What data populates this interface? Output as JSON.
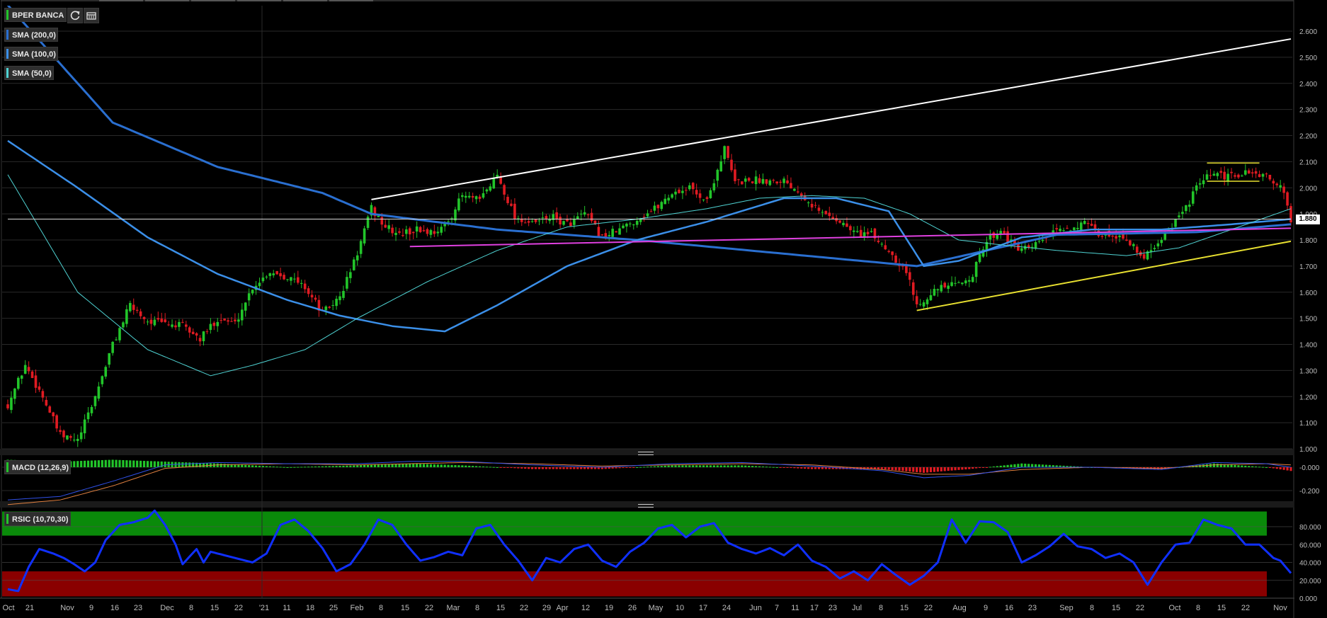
{
  "legends": {
    "main": "BPER BANCA",
    "sma200": "SMA (200,0)",
    "sma100": "SMA (100,0)",
    "sma50": "SMA (50,0)",
    "macd": "MACD (12,26,9)",
    "rsi": "RSIC (10,70,30)"
  },
  "toolbar_icons": [
    "refresh-icon",
    "calendar-icon"
  ],
  "last_price": "1.880",
  "colors": {
    "up": "#22c52a",
    "down": "#e01b22",
    "sma200": "#2a6fd0",
    "sma100": "#3b8fe8",
    "sma50": "#4fd3d3",
    "trend_white": "#ffffff",
    "trend_magenta": "#e040e0",
    "trend_yellow": "#e8e030",
    "macd_line": "#3050e8",
    "macd_signal": "#e08040",
    "macd_hist": "#22c52a",
    "rsi_line": "#1030ff",
    "rsi_overbought": "#0a8a0a",
    "rsi_oversold": "#8a0000"
  },
  "chart_data": [
    {
      "type": "candlestick",
      "title": "BPER BANCA",
      "y_ticks": [
        "1.000",
        "1.100",
        "1.200",
        "1.300",
        "1.400",
        "1.500",
        "1.600",
        "1.700",
        "1.800",
        "1.900",
        "2.000",
        "2.100",
        "2.200",
        "2.300",
        "2.400",
        "2.500",
        "2.600"
      ],
      "ylim": [
        1.0,
        2.65
      ],
      "x_ticks": [
        "Oct",
        "21",
        "Nov",
        "9",
        "16",
        "23",
        "Dec",
        "8",
        "15",
        "22",
        "'21",
        "11",
        "18",
        "25",
        "Feb",
        "8",
        "15",
        "22",
        "Mar",
        "8",
        "15",
        "22",
        "29",
        "Apr",
        "12",
        "19",
        "26",
        "May",
        "10",
        "17",
        "24",
        "Jun",
        "7",
        "11",
        "17",
        "23",
        "Jul",
        "8",
        "15",
        "22",
        "Aug",
        "9",
        "16",
        "23",
        "Sep",
        "8",
        "15",
        "22",
        "Oct",
        "8",
        "15",
        "22",
        "Nov"
      ],
      "price_keypoints": [
        [
          0,
          1.17
        ],
        [
          5,
          1.32
        ],
        [
          10,
          1.2
        ],
        [
          15,
          1.05
        ],
        [
          20,
          1.03
        ],
        [
          25,
          1.2
        ],
        [
          30,
          1.4
        ],
        [
          35,
          1.55
        ],
        [
          40,
          1.49
        ],
        [
          45,
          1.48
        ],
        [
          50,
          1.47
        ],
        [
          55,
          1.42
        ],
        [
          60,
          1.5
        ],
        [
          65,
          1.48
        ],
        [
          70,
          1.62
        ],
        [
          75,
          1.68
        ],
        [
          80,
          1.66
        ],
        [
          85,
          1.62
        ],
        [
          90,
          1.52
        ],
        [
          95,
          1.58
        ],
        [
          100,
          1.75
        ],
        [
          104,
          1.92
        ],
        [
          108,
          1.85
        ],
        [
          112,
          1.82
        ],
        [
          117,
          1.84
        ],
        [
          121,
          1.83
        ],
        [
          125,
          1.85
        ],
        [
          130,
          1.97
        ],
        [
          135,
          1.95
        ],
        [
          140,
          2.05
        ],
        [
          145,
          1.89
        ],
        [
          150,
          1.86
        ],
        [
          155,
          1.89
        ],
        [
          160,
          1.86
        ],
        [
          165,
          1.9
        ],
        [
          170,
          1.81
        ],
        [
          175,
          1.84
        ],
        [
          180,
          1.88
        ],
        [
          185,
          1.92
        ],
        [
          190,
          1.98
        ],
        [
          195,
          2.0
        ],
        [
          200,
          1.95
        ],
        [
          205,
          2.15
        ],
        [
          208,
          2.02
        ],
        [
          212,
          2.03
        ],
        [
          217,
          2.03
        ],
        [
          222,
          2.03
        ],
        [
          227,
          1.98
        ],
        [
          232,
          1.91
        ],
        [
          237,
          1.88
        ],
        [
          242,
          1.83
        ],
        [
          247,
          1.82
        ],
        [
          252,
          1.76
        ],
        [
          257,
          1.68
        ],
        [
          260,
          1.55
        ],
        [
          264,
          1.6
        ],
        [
          268,
          1.62
        ],
        [
          272,
          1.63
        ],
        [
          276,
          1.67
        ],
        [
          280,
          1.8
        ],
        [
          284,
          1.84
        ],
        [
          288,
          1.77
        ],
        [
          292,
          1.76
        ],
        [
          296,
          1.8
        ],
        [
          300,
          1.83
        ],
        [
          304,
          1.85
        ],
        [
          308,
          1.86
        ],
        [
          312,
          1.82
        ],
        [
          316,
          1.82
        ],
        [
          320,
          1.81
        ],
        [
          324,
          1.73
        ],
        [
          328,
          1.78
        ],
        [
          332,
          1.84
        ],
        [
          336,
          1.9
        ],
        [
          340,
          2.0
        ],
        [
          344,
          2.05
        ],
        [
          348,
          2.04
        ],
        [
          352,
          2.05
        ],
        [
          356,
          2.06
        ],
        [
          360,
          2.04
        ],
        [
          364,
          2.01
        ],
        [
          367,
          1.88
        ]
      ],
      "sma200_keypoints": [
        [
          0,
          2.7
        ],
        [
          10,
          2.55
        ],
        [
          30,
          2.25
        ],
        [
          60,
          2.08
        ],
        [
          90,
          1.98
        ],
        [
          104,
          1.9
        ],
        [
          140,
          1.84
        ],
        [
          180,
          1.8
        ],
        [
          220,
          1.75
        ],
        [
          260,
          1.7
        ],
        [
          300,
          1.82
        ],
        [
          340,
          1.83
        ],
        [
          367,
          1.86
        ]
      ],
      "sma100_keypoints": [
        [
          0,
          2.18
        ],
        [
          20,
          2.0
        ],
        [
          40,
          1.81
        ],
        [
          60,
          1.67
        ],
        [
          80,
          1.57
        ],
        [
          95,
          1.51
        ],
        [
          110,
          1.47
        ],
        [
          125,
          1.45
        ],
        [
          140,
          1.55
        ],
        [
          160,
          1.7
        ],
        [
          180,
          1.8
        ],
        [
          200,
          1.87
        ],
        [
          222,
          1.96
        ],
        [
          237,
          1.96
        ],
        [
          252,
          1.91
        ],
        [
          262,
          1.7
        ],
        [
          272,
          1.72
        ],
        [
          290,
          1.81
        ],
        [
          310,
          1.84
        ],
        [
          330,
          1.84
        ],
        [
          350,
          1.86
        ],
        [
          367,
          1.88
        ]
      ],
      "sma50_keypoints": [
        [
          0,
          2.05
        ],
        [
          20,
          1.6
        ],
        [
          40,
          1.38
        ],
        [
          58,
          1.28
        ],
        [
          70,
          1.32
        ],
        [
          85,
          1.38
        ],
        [
          100,
          1.5
        ],
        [
          120,
          1.64
        ],
        [
          140,
          1.76
        ],
        [
          160,
          1.85
        ],
        [
          180,
          1.88
        ],
        [
          200,
          1.92
        ],
        [
          215,
          1.96
        ],
        [
          230,
          1.97
        ],
        [
          245,
          1.96
        ],
        [
          258,
          1.9
        ],
        [
          272,
          1.8
        ],
        [
          285,
          1.78
        ],
        [
          300,
          1.76
        ],
        [
          320,
          1.74
        ],
        [
          335,
          1.77
        ],
        [
          350,
          1.84
        ],
        [
          367,
          1.92
        ]
      ],
      "trendlines": {
        "white": [
          [
            104,
            1.955
          ],
          [
            367,
            2.57
          ]
        ],
        "magenta": [
          [
            115,
            1.775
          ],
          [
            367,
            1.845
          ]
        ],
        "yellow": [
          [
            260,
            1.53
          ],
          [
            367,
            1.795
          ]
        ],
        "yellow_box_top": [
          [
            343,
            2.095
          ],
          [
            358,
            2.095
          ]
        ],
        "yellow_box_bottom": [
          [
            343,
            2.025
          ],
          [
            358,
            2.025
          ]
        ],
        "horizontal": [
          [
            0,
            1.88
          ],
          [
            367,
            1.88
          ]
        ]
      },
      "last": 1.88
    },
    {
      "type": "line",
      "title": "MACD (12,26,9)",
      "y_ticks": [
        "-0.000",
        "-0.200"
      ],
      "ylim": [
        -0.32,
        0.06
      ],
      "macd_keypoints": [
        [
          0,
          -0.28
        ],
        [
          15,
          -0.25
        ],
        [
          30,
          -0.12
        ],
        [
          45,
          0.02
        ],
        [
          60,
          0.04
        ],
        [
          80,
          0.03
        ],
        [
          100,
          0.03
        ],
        [
          115,
          0.05
        ],
        [
          130,
          0.05
        ],
        [
          150,
          0.02
        ],
        [
          170,
          0.0
        ],
        [
          190,
          0.03
        ],
        [
          210,
          0.04
        ],
        [
          230,
          0.01
        ],
        [
          250,
          -0.03
        ],
        [
          262,
          -0.09
        ],
        [
          275,
          -0.07
        ],
        [
          290,
          0.0
        ],
        [
          310,
          0.0
        ],
        [
          330,
          -0.02
        ],
        [
          345,
          0.04
        ],
        [
          360,
          0.03
        ],
        [
          367,
          0.0
        ]
      ],
      "signal_keypoints": [
        [
          0,
          -0.32
        ],
        [
          15,
          -0.28
        ],
        [
          30,
          -0.16
        ],
        [
          45,
          -0.01
        ],
        [
          60,
          0.02
        ],
        [
          80,
          0.03
        ],
        [
          100,
          0.02
        ],
        [
          115,
          0.03
        ],
        [
          130,
          0.04
        ],
        [
          150,
          0.03
        ],
        [
          170,
          0.01
        ],
        [
          190,
          0.02
        ],
        [
          210,
          0.03
        ],
        [
          230,
          0.02
        ],
        [
          250,
          -0.02
        ],
        [
          262,
          -0.06
        ],
        [
          275,
          -0.06
        ],
        [
          290,
          -0.02
        ],
        [
          310,
          0.0
        ],
        [
          330,
          -0.01
        ],
        [
          345,
          0.02
        ],
        [
          360,
          0.03
        ],
        [
          367,
          0.02
        ]
      ]
    },
    {
      "type": "line",
      "title": "RSIC (10,70,30)",
      "y_ticks": [
        "0.000",
        "20.000",
        "40.000",
        "60.000",
        "80.000"
      ],
      "ylim": [
        0,
        100
      ],
      "overbought": 70,
      "oversold": 30,
      "rsi_keypoints": [
        [
          0,
          10
        ],
        [
          3,
          8
        ],
        [
          6,
          35
        ],
        [
          9,
          55
        ],
        [
          13,
          50
        ],
        [
          16,
          45
        ],
        [
          19,
          38
        ],
        [
          22,
          30
        ],
        [
          25,
          40
        ],
        [
          28,
          65
        ],
        [
          32,
          82
        ],
        [
          36,
          85
        ],
        [
          40,
          90
        ],
        [
          42,
          98
        ],
        [
          45,
          82
        ],
        [
          48,
          60
        ],
        [
          50,
          38
        ],
        [
          54,
          55
        ],
        [
          56,
          40
        ],
        [
          58,
          52
        ],
        [
          62,
          48
        ],
        [
          66,
          44
        ],
        [
          70,
          40
        ],
        [
          74,
          50
        ],
        [
          78,
          82
        ],
        [
          82,
          88
        ],
        [
          86,
          75
        ],
        [
          90,
          56
        ],
        [
          94,
          30
        ],
        [
          98,
          38
        ],
        [
          102,
          60
        ],
        [
          106,
          88
        ],
        [
          110,
          82
        ],
        [
          114,
          60
        ],
        [
          118,
          42
        ],
        [
          122,
          46
        ],
        [
          126,
          52
        ],
        [
          130,
          48
        ],
        [
          134,
          78
        ],
        [
          138,
          82
        ],
        [
          142,
          60
        ],
        [
          146,
          42
        ],
        [
          150,
          20
        ],
        [
          154,
          45
        ],
        [
          158,
          40
        ],
        [
          162,
          55
        ],
        [
          166,
          60
        ],
        [
          170,
          42
        ],
        [
          174,
          35
        ],
        [
          178,
          52
        ],
        [
          182,
          62
        ],
        [
          186,
          78
        ],
        [
          190,
          82
        ],
        [
          194,
          68
        ],
        [
          198,
          80
        ],
        [
          202,
          84
        ],
        [
          206,
          62
        ],
        [
          210,
          55
        ],
        [
          214,
          50
        ],
        [
          218,
          56
        ],
        [
          222,
          48
        ],
        [
          226,
          60
        ],
        [
          230,
          42
        ],
        [
          234,
          35
        ],
        [
          238,
          22
        ],
        [
          242,
          30
        ],
        [
          246,
          20
        ],
        [
          250,
          38
        ],
        [
          254,
          26
        ],
        [
          258,
          15
        ],
        [
          262,
          25
        ],
        [
          266,
          40
        ],
        [
          270,
          88
        ],
        [
          274,
          62
        ],
        [
          278,
          86
        ],
        [
          282,
          85
        ],
        [
          286,
          74
        ],
        [
          290,
          40
        ],
        [
          294,
          48
        ],
        [
          298,
          58
        ],
        [
          302,
          72
        ],
        [
          306,
          58
        ],
        [
          310,
          55
        ],
        [
          314,
          45
        ],
        [
          318,
          50
        ],
        [
          322,
          40
        ],
        [
          326,
          15
        ],
        [
          330,
          40
        ],
        [
          334,
          60
        ],
        [
          338,
          62
        ],
        [
          342,
          88
        ],
        [
          346,
          82
        ],
        [
          350,
          78
        ],
        [
          354,
          60
        ],
        [
          358,
          60
        ],
        [
          362,
          45
        ],
        [
          364,
          42
        ],
        [
          367,
          28
        ]
      ]
    }
  ]
}
